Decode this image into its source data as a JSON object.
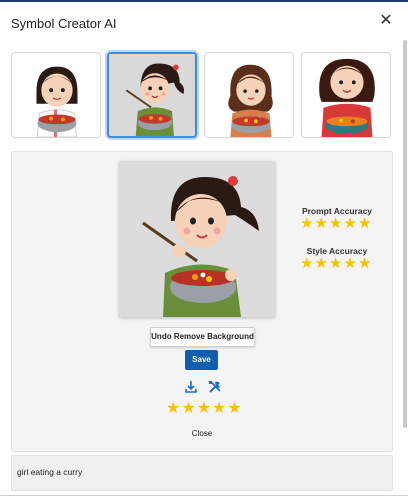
{
  "dialog": {
    "title": "Symbol Creator AI",
    "close_glyph": "✕"
  },
  "thumbnails": [
    {
      "label": "",
      "selected": false,
      "shirt": "#ffffff",
      "accent": "#e36b7d"
    },
    {
      "label": "",
      "selected": true,
      "shirt": "#6a8f3a",
      "accent": "#e03a3a"
    },
    {
      "label": "",
      "selected": false,
      "shirt": "#d67f4b",
      "accent": "#ffffff"
    },
    {
      "label": "",
      "selected": false,
      "shirt": "#d93838",
      "accent": "#ffffff"
    }
  ],
  "ratings": {
    "prompt_accuracy": {
      "label": "Prompt Accuracy",
      "value": 5,
      "max": 5
    },
    "style_accuracy": {
      "label": "Style Accuracy",
      "value": 5,
      "max": 5
    },
    "overall": {
      "value": 5,
      "max": 5
    }
  },
  "actions": {
    "undo_remove_background": "Undo Remove Background",
    "save": "Save",
    "close": "Close",
    "download_icon": "download-icon",
    "edit_tools_icon": "tools-icon"
  },
  "prompt": {
    "text": "girl eating a curry"
  },
  "colors": {
    "accent": "#0f5fae",
    "star": "#f5c400",
    "selection_border": "#3d8edb"
  }
}
